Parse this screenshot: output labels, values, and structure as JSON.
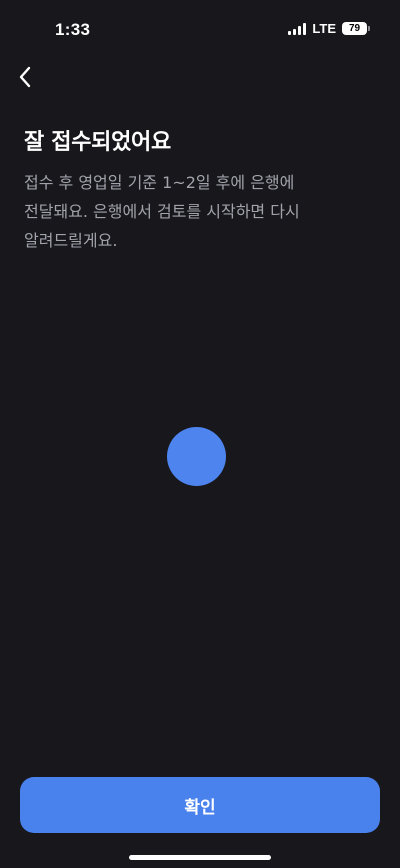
{
  "status_bar": {
    "time": "1:33",
    "network": "LTE",
    "battery": "79"
  },
  "header": {
    "back_icon": "chevron-left-icon"
  },
  "main": {
    "title": "잘 접수되었어요",
    "description_lines": [
      "접수 후 영업일 기준 1~2일 후에 은행에",
      "전달돼요. 은행에서 검토를 시작하면 다시",
      "알려드릴게요."
    ]
  },
  "footer": {
    "confirm_label": "확인"
  },
  "colors": {
    "background": "#17171c",
    "accent": "#4a82ed",
    "secondary_text": "#a2a2ab"
  }
}
